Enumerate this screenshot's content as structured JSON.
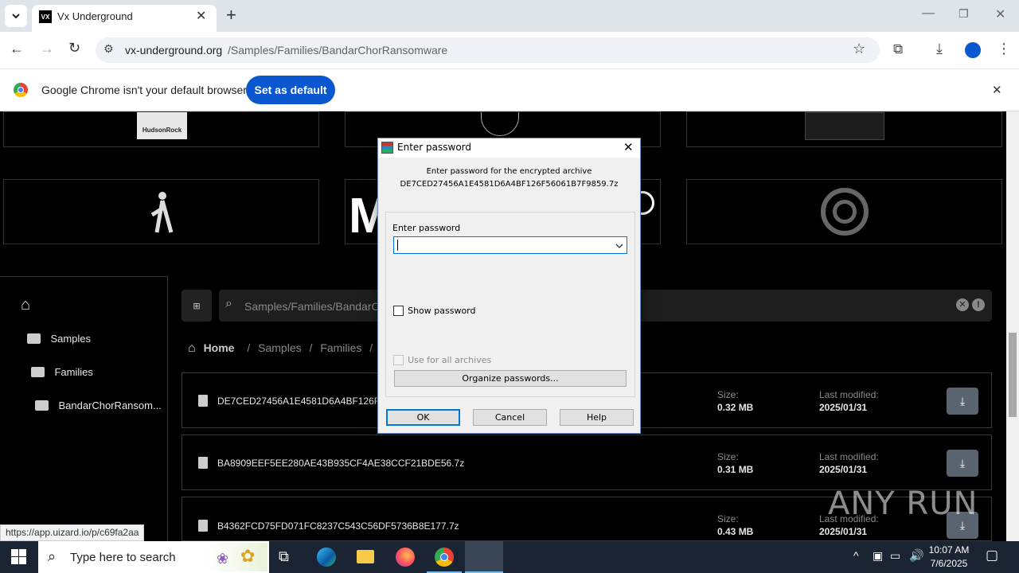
{
  "browser": {
    "tab_title": "Vx Underground",
    "favicon_text": "VX",
    "url_host": "vx-underground.org",
    "url_path": "/Samples/Families/BandarChorRansomware",
    "infobar_text": "Google Chrome isn't your default browser",
    "set_default_label": "Set as default",
    "status_url": "https://app.uizard.io/p/c69fa2aa"
  },
  "site": {
    "sidebar": [
      {
        "label": "Samples"
      },
      {
        "label": "Families"
      },
      {
        "label": "BandarChorRansom..."
      }
    ],
    "search_text": "Samples/Families/BandarCh",
    "breadcrumb": {
      "home": "Home",
      "sep1": "/",
      "crumb1": "Samples",
      "sep2": "/",
      "crumb2": "Families",
      "sep3": "/"
    },
    "logo_hudson": "HudsonRock",
    "size_label": "Size:",
    "modified_label": "Last modified:",
    "files": [
      {
        "name": "DE7CED27456A1E4581D6A4BF126F56",
        "size": "0.32 MB",
        "date": "2025/01/31"
      },
      {
        "name": "BA8909EEF5EE280AE43B935CF4AE38CCF21BDE56.7z",
        "size": "0.31 MB",
        "date": "2025/01/31"
      },
      {
        "name": "B4362FCD75FD071FC8237C543C56DF5736B8E177.7z",
        "size": "0.43 MB",
        "date": "2025/01/31"
      }
    ]
  },
  "dialog": {
    "title": "Enter password",
    "message1": "Enter password for the encrypted archive",
    "message2": "DE7CED27456A1E4581D6A4BF126F56061B7F9859.7z",
    "field_label": "Enter password",
    "field_value": "",
    "show_password": "Show password",
    "use_all": "Use for all archives",
    "organize": "Organize passwords...",
    "ok": "OK",
    "cancel": "Cancel",
    "help": "Help"
  },
  "watermark": "ANY RUN",
  "taskbar": {
    "search_placeholder": "Type here to search",
    "time": "10:07 AM",
    "date": "7/6/2025"
  },
  "colors": {
    "accent": "#0b57d0",
    "dialog_bg": "#f0f0f0",
    "taskbar": "#1b2433"
  }
}
